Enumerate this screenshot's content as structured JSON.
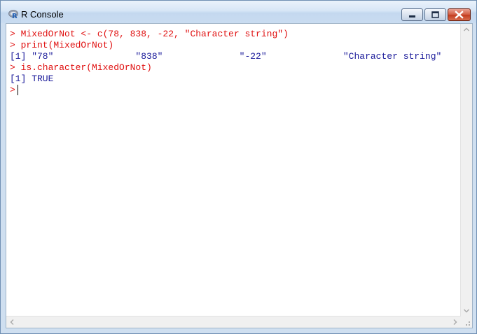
{
  "window": {
    "title": "R Console"
  },
  "console": {
    "lines": [
      {
        "text": "> MixedOrNot <- c(78, 838, -22, \"Character string\")",
        "kind": "command"
      },
      {
        "text": "> print(MixedOrNot)",
        "kind": "command"
      },
      {
        "text": "[1] \"78\"               \"838\"              \"-22\"              \"Character string\"",
        "kind": "output"
      },
      {
        "text": "> is.character(MixedOrNot)",
        "kind": "command"
      },
      {
        "text": "[1] TRUE",
        "kind": "output"
      }
    ],
    "prompt": ">"
  },
  "icons": {
    "app": "r-logo-icon",
    "minimize": "minimize-icon",
    "maximize": "maximize-icon",
    "close": "close-icon"
  },
  "colors": {
    "command_text": "#e01010",
    "output_text": "#1a1a9a",
    "title_bar": "#d7e6f6",
    "close_button": "#c23b1e"
  }
}
